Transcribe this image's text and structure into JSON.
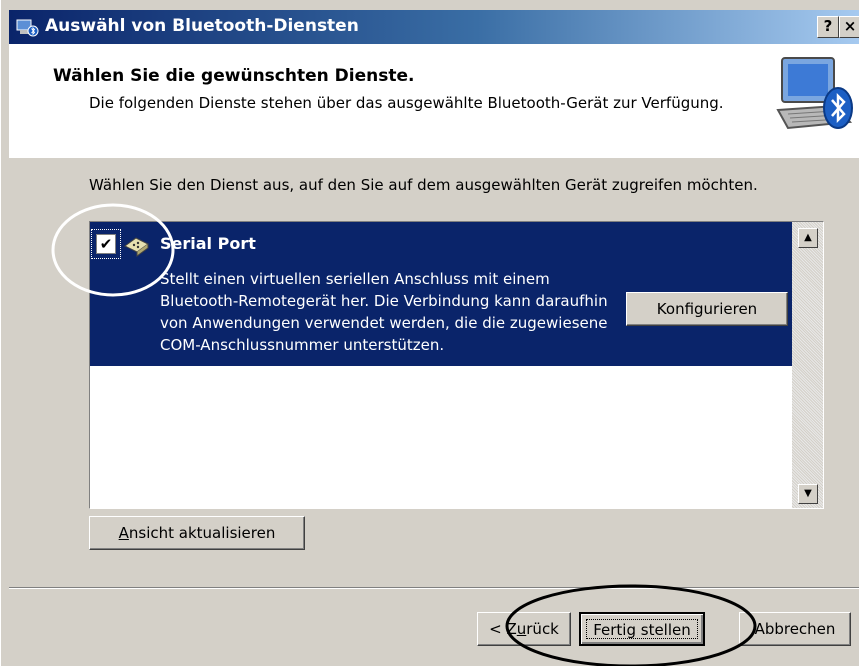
{
  "window": {
    "title": "Auswähl von Bluetooth-Diensten",
    "help_label": "?",
    "close_label": "×"
  },
  "header": {
    "title": "Wählen Sie die gewünschten Dienste.",
    "subtitle": "Die folgenden Dienste stehen über das ausgewählte Bluetooth-Gerät zur Verfügung.",
    "icon": "bluetooth-computer-icon"
  },
  "instruction": "Wählen Sie den Dienst aus, auf den Sie auf dem ausgewählten Gerät zugreifen möchten.",
  "services": [
    {
      "name": "Serial Port",
      "description": "Stellt einen virtuellen seriellen Anschluss mit einem Bluetooth-Remotegerät her. Die Verbindung kann daraufhin von Anwendungen verwendet werden, die die zugewiesene COM-Anschlussnummer unterstützen.",
      "checked": true,
      "selected": true,
      "configure_label": "Konfigurieren",
      "check_mark": "✔"
    }
  ],
  "refresh": {
    "underline": "A",
    "rest": "nsicht aktualisieren"
  },
  "footer": {
    "back": {
      "prefix": "< Z",
      "underline": "u",
      "rest": "rück"
    },
    "finish_label": "Fertig stellen",
    "cancel_label": "Abbrechen"
  },
  "scroll": {
    "up": "▲",
    "down": "▼"
  },
  "colors": {
    "selection": "#0a246a",
    "dialog": "#d4d0c8",
    "annotation": "#000000"
  }
}
